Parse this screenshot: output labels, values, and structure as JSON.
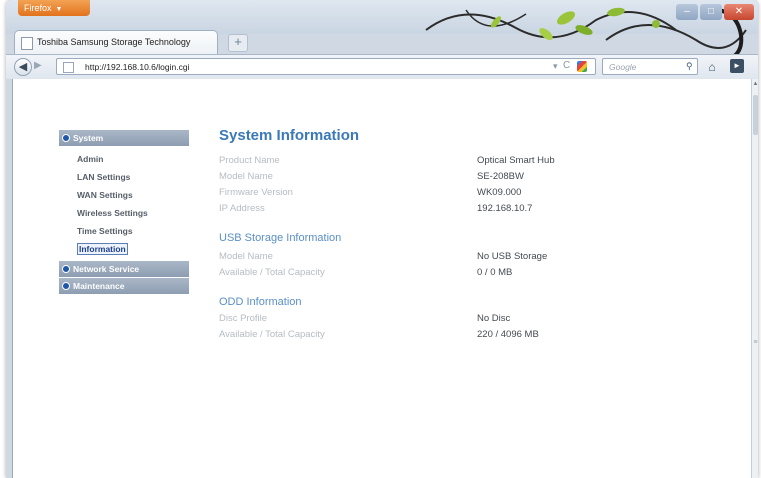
{
  "browser": {
    "menu_button": "Firefox",
    "tab_title": "Toshiba Samsung Storage Technology",
    "new_tab": "+",
    "url": "http://192.168.10.6/login.cgi",
    "search_placeholder": "Google"
  },
  "sidebar": {
    "sections": [
      {
        "label": "System"
      },
      {
        "label": "Network Service"
      },
      {
        "label": "Maintenance"
      }
    ],
    "system_items": [
      {
        "label": "Admin"
      },
      {
        "label": "LAN Settings"
      },
      {
        "label": "WAN Settings"
      },
      {
        "label": "Wireless Settings"
      },
      {
        "label": "Time Settings"
      },
      {
        "label": "Information"
      }
    ],
    "active_item": "Information"
  },
  "main": {
    "title": "System Information",
    "system_rows": [
      {
        "label": "Product Name",
        "value": "Optical Smart Hub"
      },
      {
        "label": "Model Name",
        "value": "SE-208BW"
      },
      {
        "label": "Firmware Version",
        "value": "WK09.000"
      },
      {
        "label": "IP Address",
        "value": "192.168.10.7"
      }
    ],
    "usb_title": "USB Storage Information",
    "usb_rows": [
      {
        "label": "Model Name",
        "value": "No USB Storage"
      },
      {
        "label": "Available / Total Capacity",
        "value": "0 / 0  MB"
      }
    ],
    "odd_title": "ODD Information",
    "odd_rows": [
      {
        "label": "Disc Profile",
        "value": "No Disc"
      },
      {
        "label": "Available / Total Capacity",
        "value": "220 / 4096  MB"
      }
    ]
  },
  "colors": {
    "title_blue": "#3a79b8",
    "section_blue": "#5a8fc6",
    "menu_header": "#8d9db1",
    "firefox_orange": "#e2721c"
  }
}
